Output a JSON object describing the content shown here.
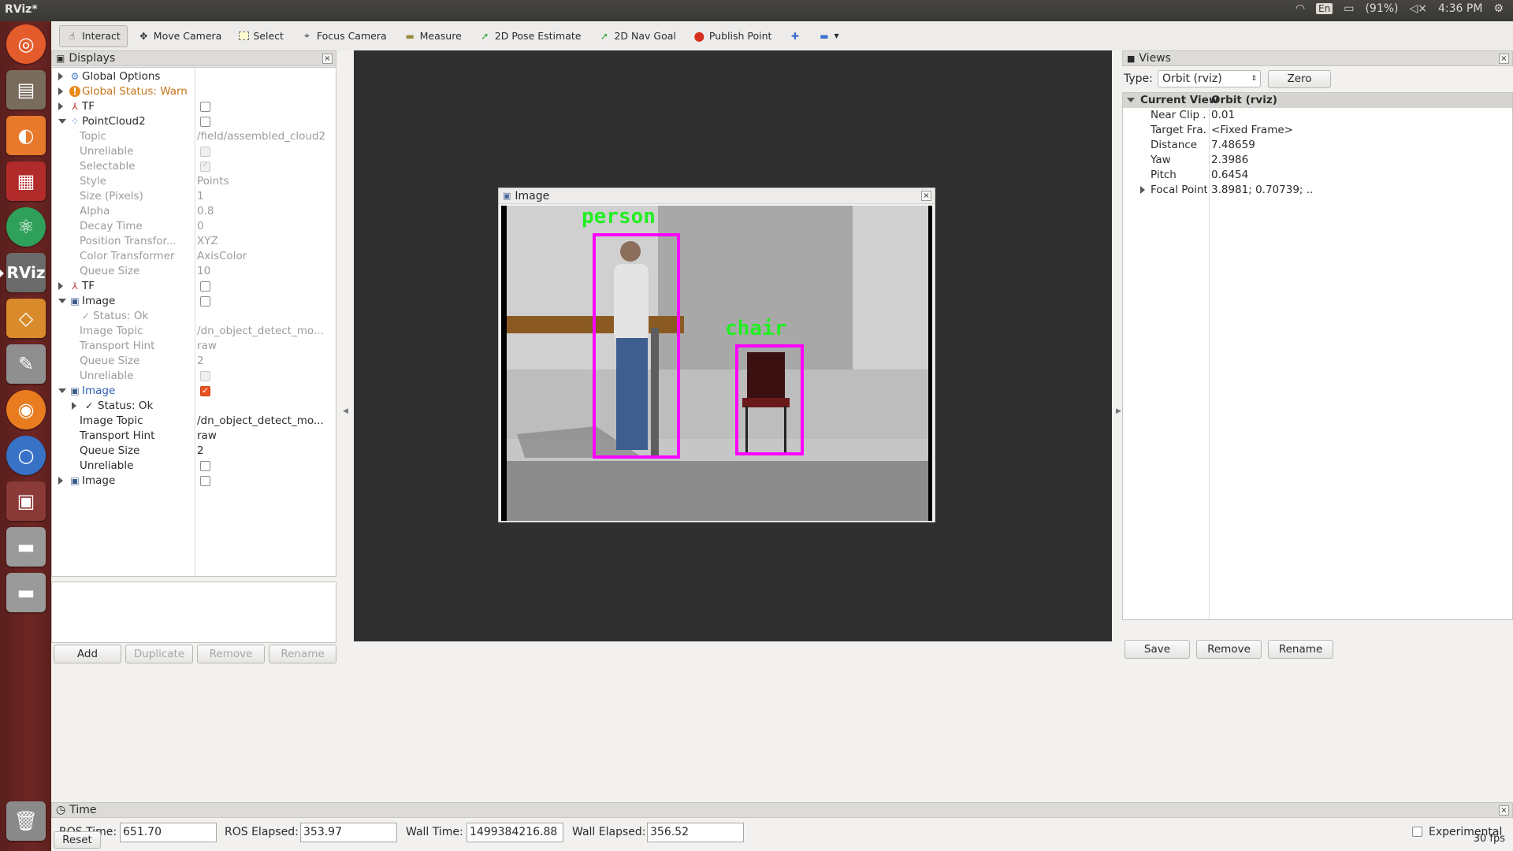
{
  "window_title": "RViz*",
  "tray": {
    "keyboard": "En",
    "battery": "(91%)",
    "clock": "4:36 PM"
  },
  "toolbar": {
    "interact": "Interact",
    "move_camera": "Move Camera",
    "select": "Select",
    "focus_camera": "Focus Camera",
    "measure": "Measure",
    "pose_estimate": "2D Pose Estimate",
    "nav_goal": "2D Nav Goal",
    "publish_point": "Publish Point"
  },
  "displays": {
    "title": "Displays",
    "rows": [
      {
        "name": "Global Options",
        "value": ""
      },
      {
        "name": "Global Status: Warn",
        "value": ""
      },
      {
        "name": "TF",
        "value": ""
      },
      {
        "name": "PointCloud2",
        "value": ""
      },
      {
        "name": "Topic",
        "value": "/field/assembled_cloud2"
      },
      {
        "name": "Unreliable",
        "value": ""
      },
      {
        "name": "Selectable",
        "value": ""
      },
      {
        "name": "Style",
        "value": "Points"
      },
      {
        "name": "Size (Pixels)",
        "value": "1"
      },
      {
        "name": "Alpha",
        "value": "0.8"
      },
      {
        "name": "Decay Time",
        "value": "0"
      },
      {
        "name": "Position Transfor...",
        "value": "XYZ"
      },
      {
        "name": "Color Transformer",
        "value": "AxisColor"
      },
      {
        "name": "Queue Size",
        "value": "10"
      },
      {
        "name": "TF",
        "value": ""
      },
      {
        "name": "Image",
        "value": ""
      },
      {
        "name": "Status: Ok",
        "value": ""
      },
      {
        "name": "Image Topic",
        "value": "/dn_object_detect_mo..."
      },
      {
        "name": "Transport Hint",
        "value": "raw"
      },
      {
        "name": "Queue Size",
        "value": "2"
      },
      {
        "name": "Unreliable",
        "value": ""
      },
      {
        "name": "Image",
        "value": ""
      },
      {
        "name": "Status: Ok",
        "value": ""
      },
      {
        "name": "Image Topic",
        "value": "/dn_object_detect_mo..."
      },
      {
        "name": "Transport Hint",
        "value": "raw"
      },
      {
        "name": "Queue Size",
        "value": "2"
      },
      {
        "name": "Unreliable",
        "value": ""
      },
      {
        "name": "Image",
        "value": ""
      }
    ],
    "buttons": {
      "add": "Add",
      "duplicate": "Duplicate",
      "remove": "Remove",
      "rename": "Rename"
    }
  },
  "image_panel": {
    "title": "Image",
    "detections": {
      "person": "person",
      "chair": "chair"
    }
  },
  "views": {
    "title": "Views",
    "type_label": "Type:",
    "type_value": "Orbit (rviz)",
    "zero": "Zero",
    "header": {
      "name": "Current View",
      "value": "Orbit (rviz)"
    },
    "rows": [
      {
        "name": "Near Clip ...",
        "value": "0.01"
      },
      {
        "name": "Target Fra...",
        "value": "<Fixed Frame>"
      },
      {
        "name": "Distance",
        "value": "7.48659"
      },
      {
        "name": "Yaw",
        "value": "2.3986"
      },
      {
        "name": "Pitch",
        "value": "0.6454"
      },
      {
        "name": "Focal Point",
        "value": "3.8981; 0.70739; ..."
      }
    ],
    "buttons": {
      "save": "Save",
      "remove": "Remove",
      "rename": "Rename"
    }
  },
  "time": {
    "title": "Time",
    "ros_time_label": "ROS Time:",
    "ros_time": "651.70",
    "ros_elapsed_label": "ROS Elapsed:",
    "ros_elapsed": "353.97",
    "wall_time_label": "Wall Time:",
    "wall_time": "1499384216.88",
    "wall_elapsed_label": "Wall Elapsed:",
    "wall_elapsed": "356.52",
    "experimental": "Experimental",
    "reset": "Reset",
    "fps": "30 fps"
  }
}
